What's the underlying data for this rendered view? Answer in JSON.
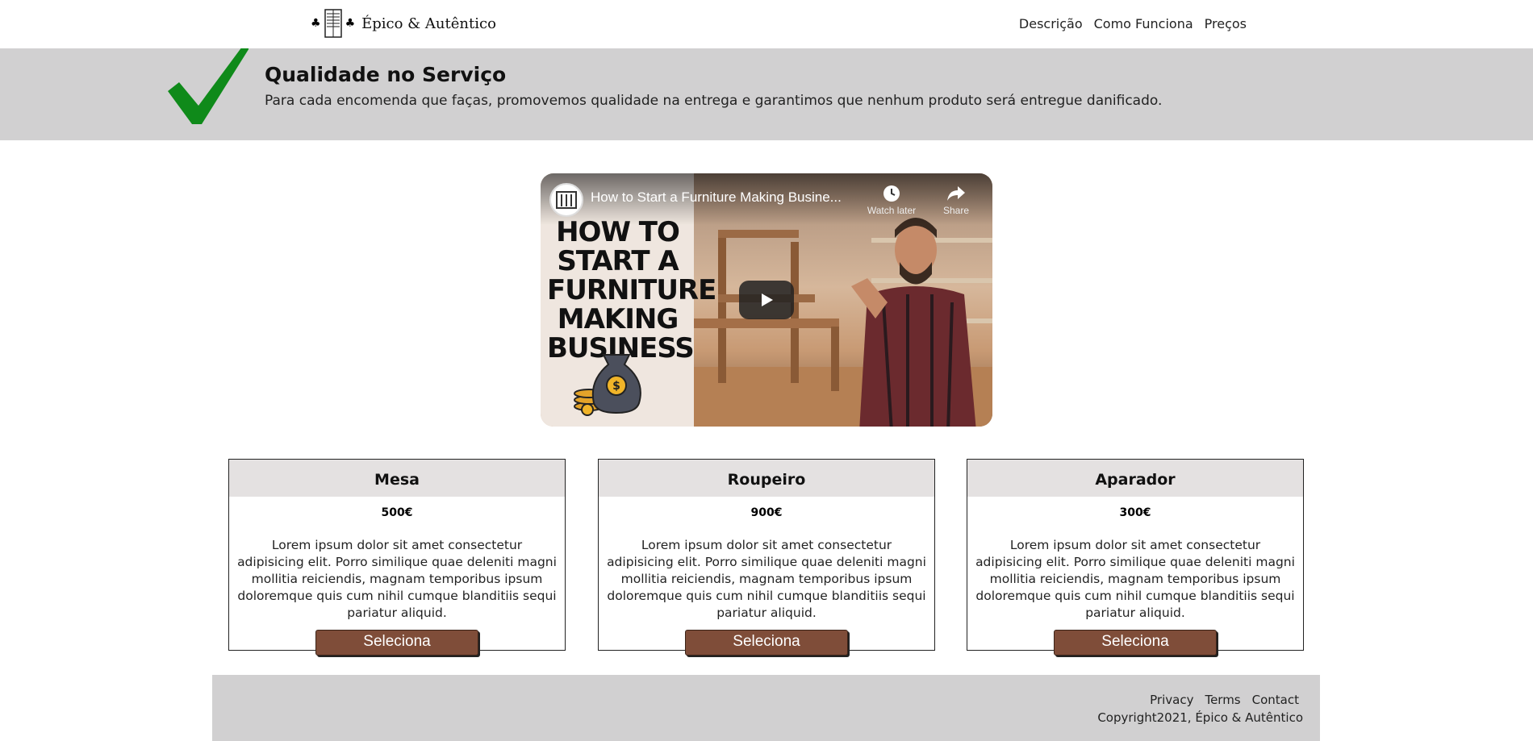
{
  "header": {
    "logo_text": "Épico & Autêntico",
    "nav": [
      {
        "label": "Descrição"
      },
      {
        "label": "Como Funciona"
      },
      {
        "label": "Preços"
      }
    ]
  },
  "banner": {
    "title": "Qualidade no Serviço",
    "text": "Para cada encomenda que faças, promovemos qualidade na entrega e garantimos que nenhum produto será entregue danificado.",
    "check_color": "#0f8a1a"
  },
  "video": {
    "title": "How to Start a Furniture Making Busine...",
    "watch_later": "Watch later",
    "share": "Share",
    "thumbnail_lines": [
      "HOW TO",
      "START A",
      "FURNITURE",
      "MAKING",
      "BUSINESS"
    ]
  },
  "cards": [
    {
      "name": "Mesa",
      "price": "500€",
      "description": "Lorem ipsum dolor sit amet consectetur adipisicing elit. Porro similique quae deleniti magni mollitia reiciendis, magnam temporibus ipsum doloremque quis cum nihil cumque blanditiis sequi pariatur aliquid.",
      "button": "Seleciona"
    },
    {
      "name": "Roupeiro",
      "price": "900€",
      "description": "Lorem ipsum dolor sit amet consectetur adipisicing elit. Porro similique quae deleniti magni mollitia reiciendis, magnam temporibus ipsum doloremque quis cum nihil cumque blanditiis sequi pariatur aliquid.",
      "button": "Seleciona"
    },
    {
      "name": "Aparador",
      "price": "300€",
      "description": "Lorem ipsum dolor sit amet consectetur adipisicing elit. Porro similique quae deleniti magni mollitia reiciendis, magnam temporibus ipsum doloremque quis cum nihil cumque blanditiis sequi pariatur aliquid.",
      "button": "Seleciona"
    }
  ],
  "footer": {
    "links": [
      {
        "label": "Privacy"
      },
      {
        "label": "Terms"
      },
      {
        "label": "Contact"
      }
    ],
    "copyright": "Copyright2021, Épico & Autêntico"
  },
  "colors": {
    "button": "#7f4d39",
    "banner_bg": "#d1d0d1",
    "card_head_bg": "#e4e1e1"
  }
}
